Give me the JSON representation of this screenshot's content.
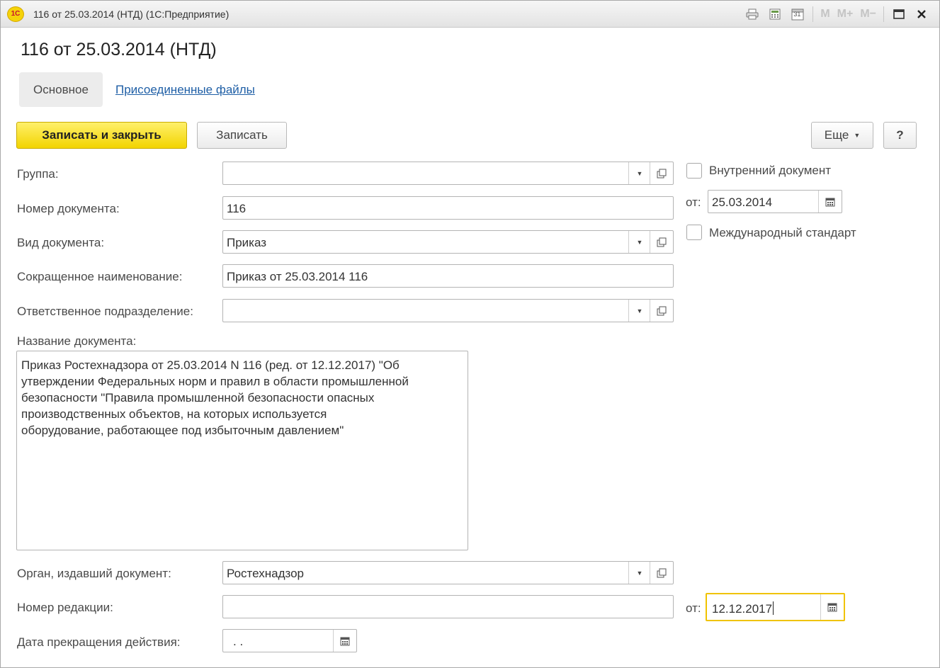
{
  "window": {
    "title": "116 от 25.03.2014 (НТД)  (1С:Предприятие)",
    "logo_text": "1С",
    "toolbar_m": "M",
    "toolbar_mplus": "M+",
    "toolbar_mminus": "M−",
    "calendar_day": "31"
  },
  "header": {
    "title": "116 от 25.03.2014 (НТД)",
    "tab_main": "Основное",
    "tab_files": "Присоединенные файлы"
  },
  "toolbar": {
    "save_close": "Записать и закрыть",
    "save": "Записать",
    "more": "Еще",
    "help": "?"
  },
  "form": {
    "group": {
      "label": "Группа:",
      "value": ""
    },
    "doc_number": {
      "label": "Номер документа:",
      "value": "116"
    },
    "doc_type": {
      "label": "Вид документа:",
      "value": "Приказ"
    },
    "short_name": {
      "label": "Сокращенное наименование:",
      "value": "Приказ от 25.03.2014 116"
    },
    "responsible_dept": {
      "label": "Ответственное подразделение:",
      "value": ""
    },
    "doc_name": {
      "label": "Название документа:",
      "value": "Приказ Ростехнадзора от 25.03.2014 N 116 (ред. от 12.12.2017) \"Об\nутверждении Федеральных норм и правил в области промышленной\nбезопасности \"Правила промышленной безопасности опасных\nпроизводственных объектов, на которых используется\nоборудование, работающее под избыточным давлением\""
    },
    "issuer": {
      "label": "Орган, издавший документ:",
      "value": "Ростехнадзор"
    },
    "revision_number": {
      "label": "Номер редакции:",
      "value": ""
    },
    "end_date": {
      "label": "Дата прекращения действия:",
      "value": " .  ."
    },
    "internal_doc": {
      "label": "Внутренний документ",
      "checked": false
    },
    "doc_date": {
      "label": "от:",
      "value": "25.03.2014"
    },
    "intl_standard": {
      "label": "Международный стандарт",
      "checked": false
    },
    "revision_date": {
      "label": "от:",
      "value": "12.12.2017"
    }
  },
  "colors": {
    "primary_button": "#f2d400",
    "link": "#1f5fa6",
    "focus_border": "#f0c300"
  }
}
